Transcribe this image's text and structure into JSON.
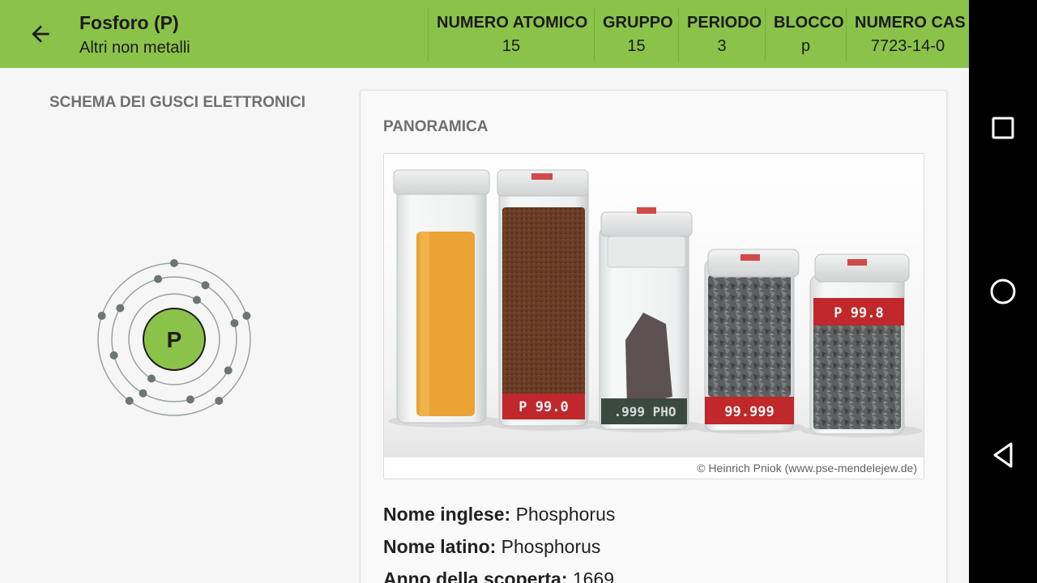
{
  "header": {
    "title": "Fosforo (P)",
    "subtitle": "Altri non metalli",
    "stats": [
      {
        "label": "NUMERO ATOMICO",
        "value": "15"
      },
      {
        "label": "GRUPPO",
        "value": "15"
      },
      {
        "label": "PERIODO",
        "value": "3"
      },
      {
        "label": "BLOCCO",
        "value": "p"
      },
      {
        "label": "NUMERO CAS",
        "value": "7723-14-0"
      }
    ]
  },
  "shell": {
    "title": "SCHEMA DEI GUSCI ELETTRONICI",
    "symbol": "P",
    "electrons_per_shell": [
      2,
      8,
      5
    ]
  },
  "overview": {
    "title": "PANORAMICA",
    "photo_credit": "© Heinrich Pniok (www.pse-mendelejew.de)",
    "jar_labels": [
      "P 99.0",
      ".999 PHO",
      "99.999",
      "P 99.8"
    ],
    "facts": [
      {
        "label": "Nome inglese:",
        "value": "Phosphorus"
      },
      {
        "label": "Nome latino:",
        "value": "Phosphorus"
      },
      {
        "label": "Anno della scoperta:",
        "value": "1669"
      }
    ]
  },
  "colors": {
    "accent": "#8bc34a",
    "nucleus": "#8bc34a",
    "orbit": "#9aa0a2",
    "electron": "#6c7577"
  },
  "navbar": {
    "icons": [
      "recents-square-icon",
      "home-circle-icon",
      "back-triangle-icon"
    ]
  }
}
